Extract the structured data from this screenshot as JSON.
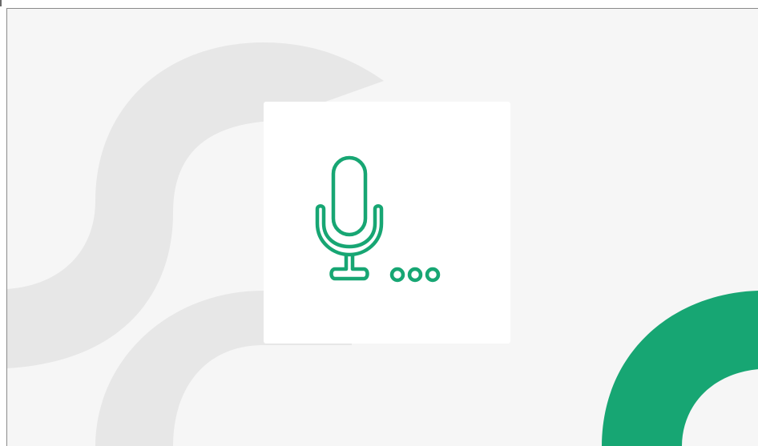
{
  "accent_color": "#17a673",
  "decor_color": "#e7e7e7",
  "background_color": "#f6f6f6",
  "card_color": "#ffffff",
  "icons": {
    "center_icon": "microphone-with-dots-icon"
  }
}
